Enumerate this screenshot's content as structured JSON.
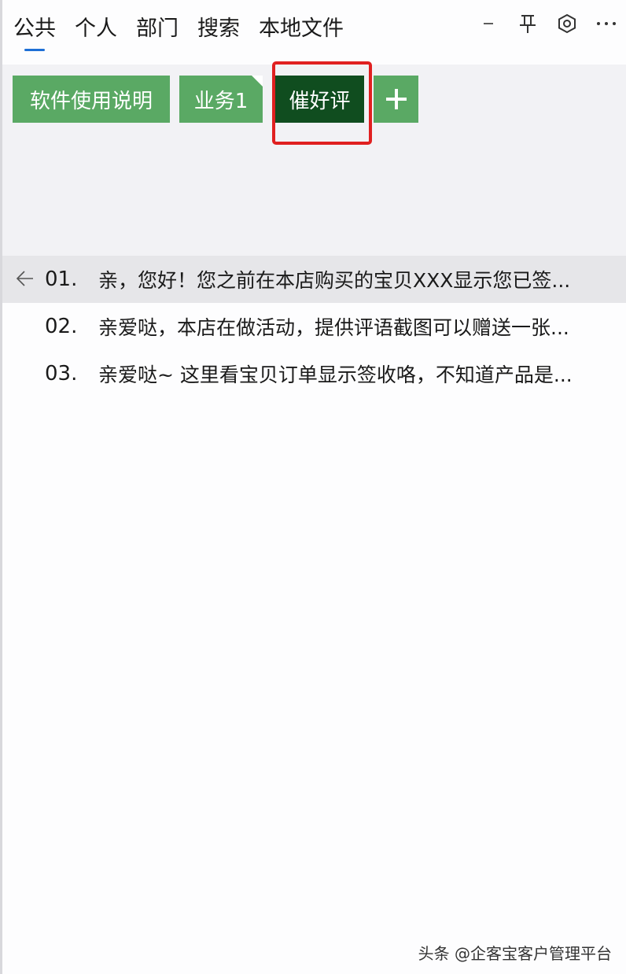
{
  "nav": {
    "tabs": [
      {
        "label": "公共",
        "active": true
      },
      {
        "label": "个人"
      },
      {
        "label": "部门"
      },
      {
        "label": "搜索"
      },
      {
        "label": "本地文件"
      }
    ]
  },
  "window_controls": [
    "minimize-icon",
    "pin-icon",
    "settings-icon",
    "more-icon"
  ],
  "toolbar": {
    "buttons": [
      {
        "label": "软件使用说明"
      },
      {
        "label": "业务1"
      },
      {
        "label": "催好评",
        "selected": true
      },
      {
        "label": "+",
        "icon": "plus-icon"
      }
    ],
    "accent_color": "#5aa964",
    "selected_color": "#104d1f",
    "highlight_color": "#e02020"
  },
  "list": {
    "items": [
      {
        "num": "01.",
        "text": "亲，您好！您之前在本店购买的宝贝XXX显示您已签..."
      },
      {
        "num": "02.",
        "text": "亲爱哒，本店在做活动，提供评语截图可以赠送一张..."
      },
      {
        "num": "03.",
        "text": "亲爱哒~ 这里看宝贝订单显示签收咯，不知道产品是..."
      }
    ]
  },
  "watermark": "头条 @企客宝客户管理平台"
}
